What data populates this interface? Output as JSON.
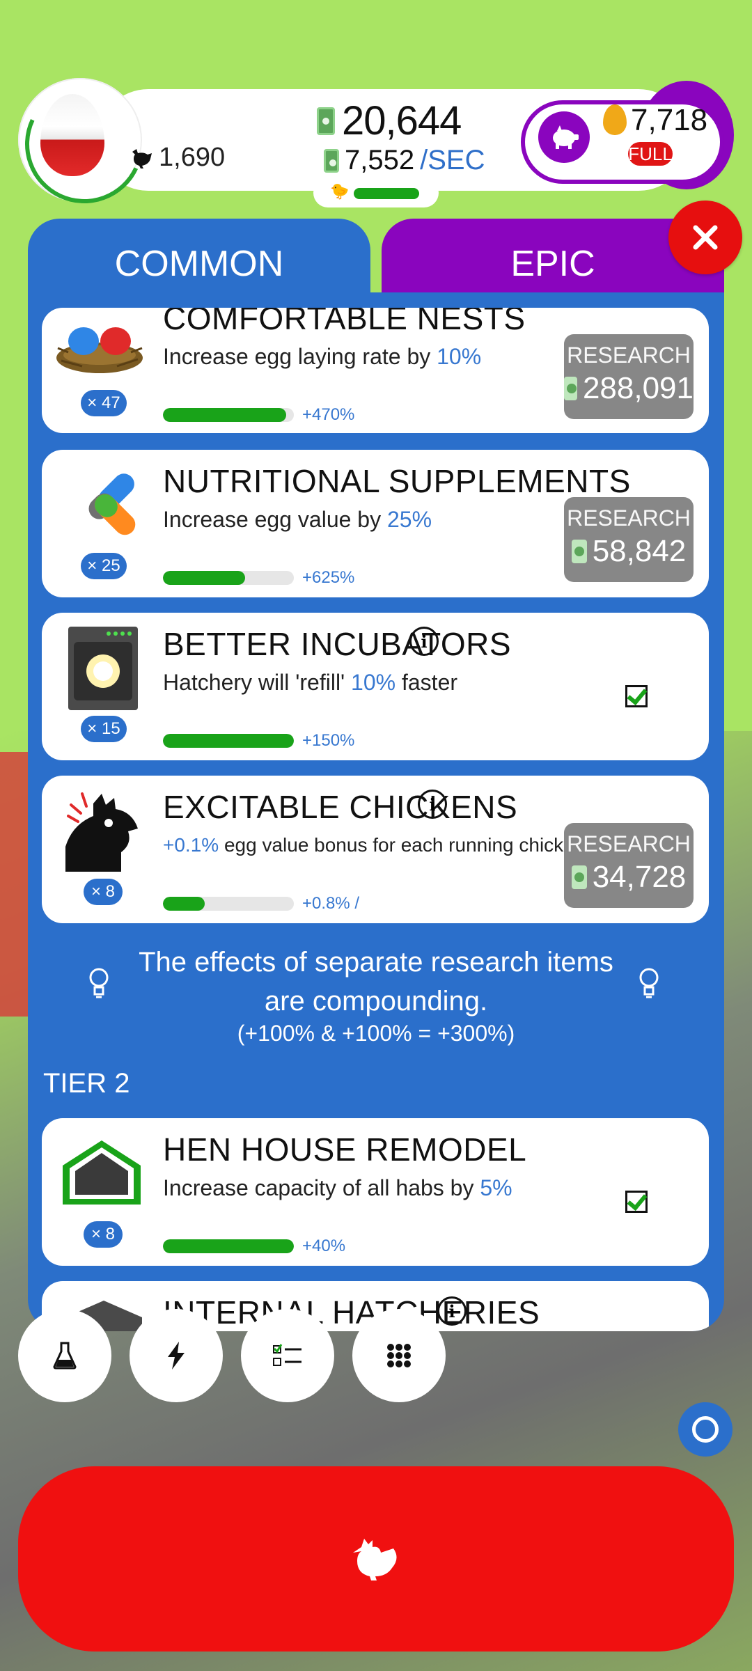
{
  "header": {
    "chicken_count": "1,690",
    "cash": "20,644",
    "cash_rate_value": "7,552",
    "cash_rate_unit": "/SEC",
    "golden_eggs": "7,718",
    "silo_status": "FULL"
  },
  "tabs": {
    "common": "COMMON",
    "epic": "EPIC"
  },
  "research": [
    {
      "title": "COMFORTABLE NESTS",
      "desc_prefix": "Increase egg laying rate by ",
      "desc_value": "10%",
      "desc_suffix": "",
      "level": "× 47",
      "progress": "+470%",
      "progress_fraction": 0.94,
      "button_label": "RESEARCH",
      "cost": "288,091"
    },
    {
      "title": "NUTRITIONAL SUPPLEMENTS",
      "desc_prefix": "Increase egg value by ",
      "desc_value": "25%",
      "desc_suffix": "",
      "level": "× 25",
      "progress": "+625%",
      "progress_fraction": 0.625,
      "button_label": "RESEARCH",
      "cost": "58,842"
    },
    {
      "title": "BETTER INCUBATORS",
      "desc_prefix": "Hatchery will 'refill' ",
      "desc_value": "10%",
      "desc_suffix": " faster",
      "level": "× 15",
      "progress": "+150%",
      "progress_fraction": 1.0,
      "completed": true
    },
    {
      "title": "EXCITABLE CHICKENS",
      "desc_prefix": "",
      "desc_value": "+0.1%",
      "desc_suffix": " egg value bonus for each running chicken",
      "level": "× 8",
      "progress": "+0.8% /",
      "progress_fraction": 0.32,
      "button_label": "RESEARCH",
      "cost": "34,728"
    }
  ],
  "tip": {
    "text": "The effects of separate research items are compounding.",
    "example": "(+100% & +100% = +300%)"
  },
  "tier2": {
    "label": "TIER 2",
    "items": [
      {
        "title": "HEN HOUSE REMODEL",
        "desc_prefix": "Increase capacity of all habs by ",
        "desc_value": "5%",
        "level": "× 8",
        "progress": "+40%",
        "progress_fraction": 1.0,
        "completed": true
      },
      {
        "title": "INTERNAL HATCHERIES"
      }
    ]
  },
  "icons": {
    "lab": "flask-icon",
    "boost": "lightning-icon",
    "missions": "checklist-icon",
    "menu": "grid-icon"
  },
  "colors": {
    "panel_blue": "#2b6fcb",
    "epic_purple": "#8a05be",
    "hatch_red": "#f01010",
    "progress_green": "#19a319"
  }
}
